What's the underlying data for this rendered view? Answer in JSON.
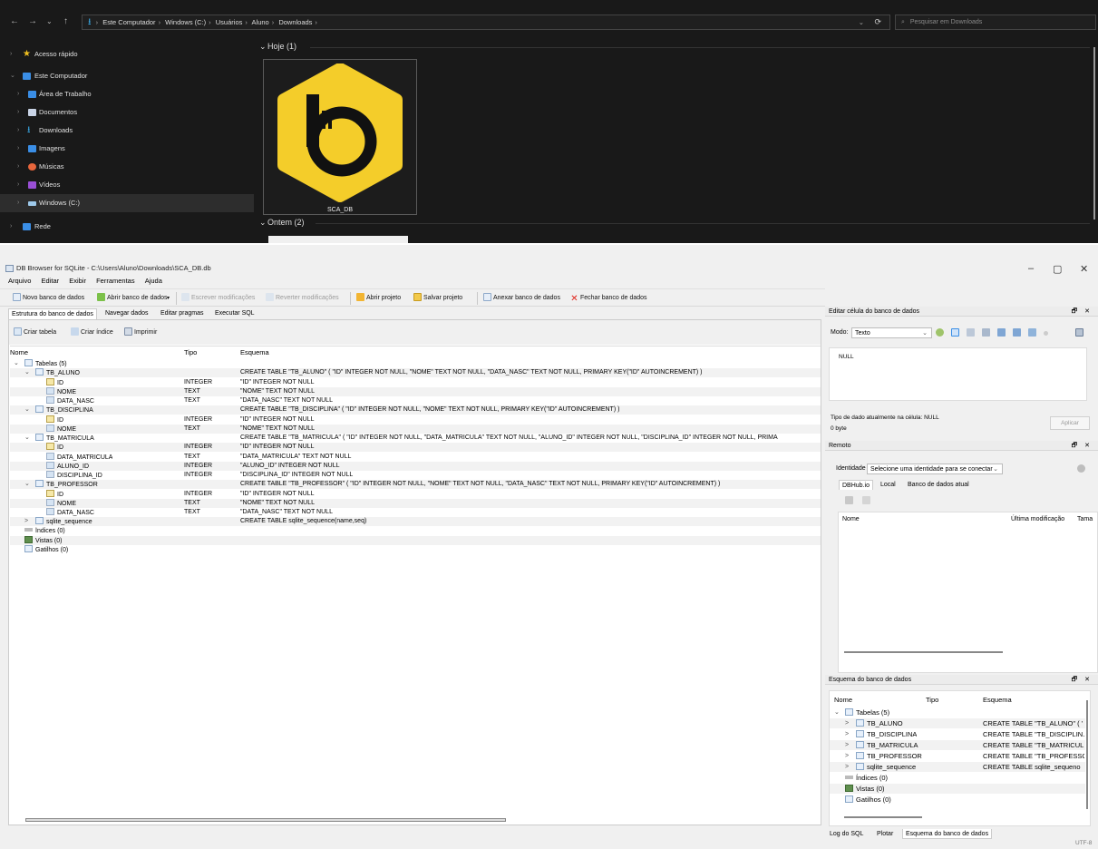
{
  "explorer": {
    "nav_back": "←",
    "nav_forward": "→",
    "nav_recent": "⌄",
    "nav_up": "↑",
    "breadcrumb": [
      "Este Computador",
      "Windows (C:)",
      "Usuários",
      "Aluno",
      "Downloads"
    ],
    "refresh_icon": "⟳",
    "history_icon": "⌄",
    "search_placeholder": "Pesquisar em Downloads",
    "sidebar": [
      {
        "label": "Acesso rápido",
        "icon": "star-icon",
        "color": "#f0c020"
      },
      {
        "label": "Este Computador",
        "icon": "computer-icon",
        "color": "#3a8ee6"
      },
      {
        "label": "Área de Trabalho",
        "icon": "desktop-icon",
        "color": "#3a8ee6"
      },
      {
        "label": "Documentos",
        "icon": "document-icon",
        "color": "#c9d4e6"
      },
      {
        "label": "Downloads",
        "icon": "download-icon",
        "color": "#3ab0ef"
      },
      {
        "label": "Imagens",
        "icon": "image-icon",
        "color": "#3a8ee6"
      },
      {
        "label": "Músicas",
        "icon": "music-icon",
        "color": "#e8663c"
      },
      {
        "label": "Vídeos",
        "icon": "video-icon",
        "color": "#9a4fd6"
      },
      {
        "label": "Windows (C:)",
        "icon": "drive-icon",
        "color": "#9ec9ea"
      },
      {
        "label": "Rede",
        "icon": "network-icon",
        "color": "#3a8ee6"
      }
    ],
    "groups": [
      {
        "label": "Hoje (1)"
      },
      {
        "label": "Ontem (2)"
      }
    ],
    "file_name": "SCA_DB",
    "logo_color": "#f4cd2a"
  },
  "app": {
    "title": "DB Browser for SQLite - C:\\Users\\Aluno\\Downloads\\SCA_DB.db",
    "win_min": "–",
    "win_restore": "▢",
    "win_close": "✕",
    "menu": [
      "Arquivo",
      "Editar",
      "Exibir",
      "Ferramentas",
      "Ajuda"
    ],
    "toolbar": {
      "new_db": "Novo banco de dados",
      "open_db": "Abrir banco de dados",
      "write_changes": "Escrever modificações",
      "revert_changes": "Reverter modificações",
      "open_project": "Abrir projeto",
      "save_project": "Salvar projeto",
      "attach_db": "Anexar banco de dados",
      "close_db": "Fechar banco de dados"
    },
    "tabs": [
      "Estrutura do banco de dados",
      "Navegar dados",
      "Editar pragmas",
      "Executar SQL"
    ],
    "structure_tools": {
      "create_table": "Criar tabela",
      "create_index": "Criar índice",
      "print": "Imprimir"
    },
    "tree_headers": {
      "name": "Nome",
      "type": "Tipo",
      "schema": "Esquema"
    },
    "tree": [
      {
        "depth": 0,
        "exp": "⌄",
        "icon": "table",
        "name": "Tabelas (5)",
        "type": "",
        "schema": ""
      },
      {
        "depth": 1,
        "exp": "⌄",
        "icon": "table",
        "name": "TB_ALUNO",
        "type": "",
        "schema": "CREATE TABLE \"TB_ALUNO\" ( \"ID\" INTEGER NOT NULL, \"NOME\" TEXT NOT NULL, \"DATA_NASC\" TEXT NOT NULL, PRIMARY KEY(\"ID\" AUTOINCREMENT) )"
      },
      {
        "depth": 2,
        "exp": "",
        "icon": "key",
        "name": "ID",
        "type": "INTEGER",
        "schema": "\"ID\" INTEGER NOT NULL"
      },
      {
        "depth": 2,
        "exp": "",
        "icon": "col",
        "name": "NOME",
        "type": "TEXT",
        "schema": "\"NOME\" TEXT NOT NULL"
      },
      {
        "depth": 2,
        "exp": "",
        "icon": "col",
        "name": "DATA_NASC",
        "type": "TEXT",
        "schema": "\"DATA_NASC\" TEXT NOT NULL"
      },
      {
        "depth": 1,
        "exp": "⌄",
        "icon": "table",
        "name": "TB_DISCIPLINA",
        "type": "",
        "schema": "CREATE TABLE \"TB_DISCIPLINA\" ( \"ID\" INTEGER NOT NULL, \"NOME\" TEXT NOT NULL, PRIMARY KEY(\"ID\" AUTOINCREMENT) )"
      },
      {
        "depth": 2,
        "exp": "",
        "icon": "key",
        "name": "ID",
        "type": "INTEGER",
        "schema": "\"ID\" INTEGER NOT NULL"
      },
      {
        "depth": 2,
        "exp": "",
        "icon": "col",
        "name": "NOME",
        "type": "TEXT",
        "schema": "\"NOME\" TEXT NOT NULL"
      },
      {
        "depth": 1,
        "exp": "⌄",
        "icon": "table",
        "name": "TB_MATRICULA",
        "type": "",
        "schema": "CREATE TABLE \"TB_MATRICULA\" ( \"ID\" INTEGER NOT NULL, \"DATA_MATRICULA\" TEXT NOT NULL, \"ALUNO_ID\" INTEGER NOT NULL, \"DISCIPLINA_ID\" INTEGER NOT NULL, PRIMA"
      },
      {
        "depth": 2,
        "exp": "",
        "icon": "key",
        "name": "ID",
        "type": "INTEGER",
        "schema": "\"ID\" INTEGER NOT NULL"
      },
      {
        "depth": 2,
        "exp": "",
        "icon": "col",
        "name": "DATA_MATRICULA",
        "type": "TEXT",
        "schema": "\"DATA_MATRICULA\" TEXT NOT NULL"
      },
      {
        "depth": 2,
        "exp": "",
        "icon": "col",
        "name": "ALUNO_ID",
        "type": "INTEGER",
        "schema": "\"ALUNO_ID\" INTEGER NOT NULL"
      },
      {
        "depth": 2,
        "exp": "",
        "icon": "col",
        "name": "DISCIPLINA_ID",
        "type": "INTEGER",
        "schema": "\"DISCIPLINA_ID\" INTEGER NOT NULL"
      },
      {
        "depth": 1,
        "exp": "⌄",
        "icon": "table",
        "name": "TB_PROFESSOR",
        "type": "",
        "schema": "CREATE TABLE \"TB_PROFESSOR\" ( \"ID\" INTEGER NOT NULL, \"NOME\" TEXT NOT NULL, \"DATA_NASC\" TEXT NOT NULL, PRIMARY KEY(\"ID\" AUTOINCREMENT) )"
      },
      {
        "depth": 2,
        "exp": "",
        "icon": "key",
        "name": "ID",
        "type": "INTEGER",
        "schema": "\"ID\" INTEGER NOT NULL"
      },
      {
        "depth": 2,
        "exp": "",
        "icon": "col",
        "name": "NOME",
        "type": "TEXT",
        "schema": "\"NOME\" TEXT NOT NULL"
      },
      {
        "depth": 2,
        "exp": "",
        "icon": "col",
        "name": "DATA_NASC",
        "type": "TEXT",
        "schema": "\"DATA_NASC\" TEXT NOT NULL"
      },
      {
        "depth": 1,
        "exp": ">",
        "icon": "table",
        "name": "sqlite_sequence",
        "type": "",
        "schema": "CREATE TABLE sqlite_sequence(name,seq)"
      },
      {
        "depth": 0,
        "exp": "",
        "icon": "idx",
        "name": "Índices (0)",
        "type": "",
        "schema": ""
      },
      {
        "depth": 0,
        "exp": "",
        "icon": "view",
        "name": "Vistas (0)",
        "type": "",
        "schema": ""
      },
      {
        "depth": 0,
        "exp": "",
        "icon": "trig",
        "name": "Gatilhos (0)",
        "type": "",
        "schema": ""
      }
    ],
    "edit_cell": {
      "title": "Editar célula do banco de dados",
      "mode_label": "Modo:",
      "mode_value": "Texto",
      "value": "NULL",
      "type_info": "Tipo de dado atualmente na célula: NULL",
      "size_info": "0 byte",
      "apply": "Aplicar"
    },
    "remote": {
      "title": "Remoto",
      "identity_label": "Identidade",
      "identity_value": "Selecione uma identidade para se conectar",
      "tabs": [
        "DBHub.io",
        "Local",
        "Banco de dados atual"
      ],
      "col_name": "Nome",
      "col_modified": "Última modificação",
      "col_size": "Tama"
    },
    "schema_panel": {
      "title": "Esquema do banco de dados",
      "headers": {
        "name": "Nome",
        "type": "Tipo",
        "schema": "Esquema"
      },
      "rows": [
        {
          "depth": 0,
          "exp": "⌄",
          "icon": "table",
          "name": "Tabelas (5)",
          "schema": ""
        },
        {
          "depth": 1,
          "exp": ">",
          "icon": "table",
          "name": "TB_ALUNO",
          "schema": "CREATE TABLE \"TB_ALUNO\" ( '"
        },
        {
          "depth": 1,
          "exp": ">",
          "icon": "table",
          "name": "TB_DISCIPLINA",
          "schema": "CREATE TABLE \"TB_DISCIPLIN."
        },
        {
          "depth": 1,
          "exp": ">",
          "icon": "table",
          "name": "TB_MATRICULA",
          "schema": "CREATE TABLE \"TB_MATRICUL"
        },
        {
          "depth": 1,
          "exp": ">",
          "icon": "table",
          "name": "TB_PROFESSOR",
          "schema": "CREATE TABLE \"TB_PROFESSC"
        },
        {
          "depth": 1,
          "exp": ">",
          "icon": "table",
          "name": "sqlite_sequence",
          "schema": "CREATE TABLE sqlite_sequeno"
        },
        {
          "depth": 0,
          "exp": "",
          "icon": "idx",
          "name": "Índices (0)",
          "schema": ""
        },
        {
          "depth": 0,
          "exp": "",
          "icon": "view",
          "name": "Vistas (0)",
          "schema": ""
        },
        {
          "depth": 0,
          "exp": "",
          "icon": "trig",
          "name": "Gatilhos (0)",
          "schema": ""
        }
      ]
    },
    "bottom_tabs": [
      "Log do SQL",
      "Plotar",
      "Esquema do banco de dados"
    ],
    "encoding": "UTF-8",
    "dock_buttons": "🗗 ✕"
  }
}
